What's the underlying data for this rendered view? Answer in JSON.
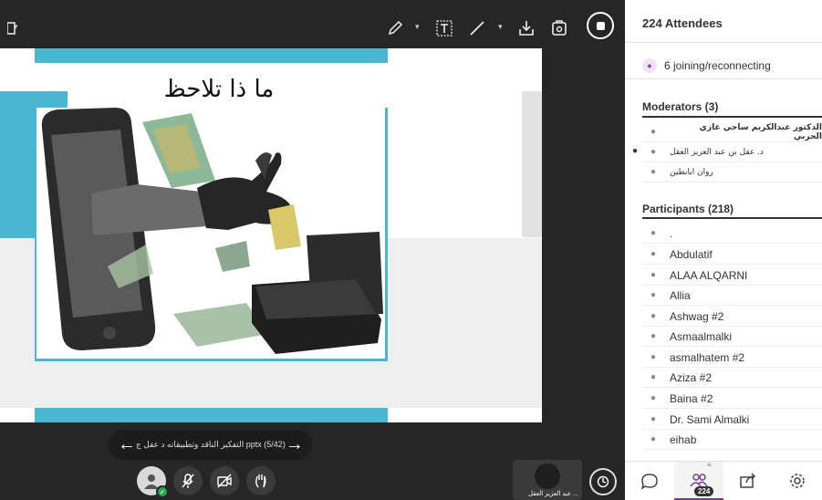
{
  "slide": {
    "title": "ما ذا تلاحظ",
    "filename": "التفكير الناقد وتطبيقاته د عقل ج pptx",
    "page": "(5/42)"
  },
  "panel": {
    "title": "224 Attendees",
    "joining": "6 joining/reconnecting",
    "moderators_header": "Moderators (3)",
    "moderators": [
      "الدكتور عبدالكريم ساجي غازي الحربي",
      "د. عقل بن عبد العزيز العقل",
      "روان ابابطين"
    ],
    "participants_header": "Participants (218)",
    "participants": [
      ".",
      "Abdulatif",
      "ALAA ALQARNI",
      "Allia",
      "Ashwag #2",
      "Asmaalmalki",
      "asmalhatem #2",
      "Aziza #2",
      "Baina #2",
      "Dr. Sami Almalki",
      "eihab"
    ],
    "badge": "224"
  },
  "speaker": {
    "name": "... عبد العزيز العقل"
  },
  "icons": {
    "toolbar": [
      "pen-icon",
      "text-icon",
      "line-icon",
      "download-icon",
      "save-icon",
      "stop-icon"
    ],
    "footer": [
      "chat-icon",
      "attendees-icon",
      "share-icon",
      "settings-icon"
    ]
  },
  "colors": {
    "accent": "#4bb6d1",
    "brand": "#7a3c92",
    "stage": "#262626"
  }
}
